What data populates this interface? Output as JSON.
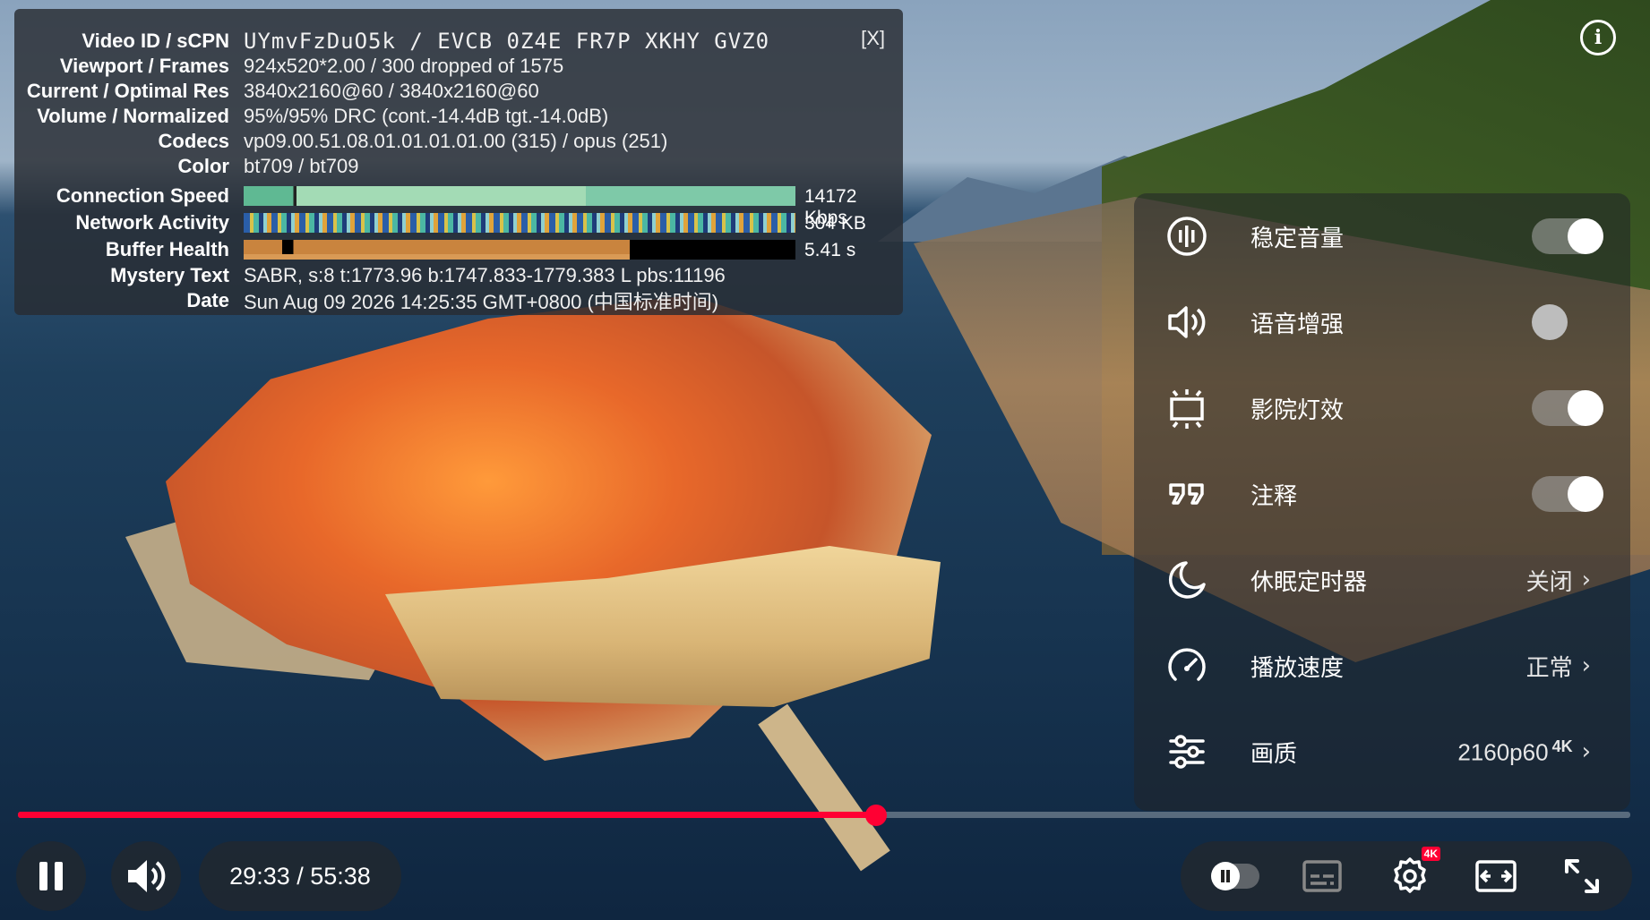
{
  "stats": {
    "close_label": "[X]",
    "rows": [
      {
        "label": "Video ID / sCPN",
        "value": "UYmvFzDuO5k / EVCB 0Z4E FR7P XKHY GVZ0"
      },
      {
        "label": "Viewport / Frames",
        "value": "924x520*2.00 / 300 dropped of 1575"
      },
      {
        "label": "Current / Optimal Res",
        "value": "3840x2160@60 / 3840x2160@60"
      },
      {
        "label": "Volume / Normalized",
        "value": "95%/95% DRC (cont.-14.4dB tgt.-14.0dB)"
      },
      {
        "label": "Codecs",
        "value": "vp09.00.51.08.01.01.01.01.00 (315) / opus (251)"
      },
      {
        "label": "Color",
        "value": "bt709 / bt709"
      },
      {
        "label": "Connection Speed",
        "value": "14172 Kbps"
      },
      {
        "label": "Network Activity",
        "value": "304 KB"
      },
      {
        "label": "Buffer Health",
        "value": "5.41 s"
      },
      {
        "label": "Mystery Text",
        "value": "SABR, s:8 t:1773.96 b:1747.833-1779.383 L pbs:11196"
      },
      {
        "label": "Date",
        "value": "Sun Aug 09 2026 14:25:35 GMT+0800 (中国标准时间)"
      }
    ]
  },
  "settings": {
    "items": [
      {
        "label": "稳定音量",
        "icon": "stable-volume-icon",
        "toggle": true
      },
      {
        "label": "语音增强",
        "icon": "voice-boost-icon",
        "toggle": false
      },
      {
        "label": "影院灯效",
        "icon": "ambient-mode-icon",
        "toggle": true
      },
      {
        "label": "注释",
        "icon": "annotations-icon",
        "toggle": true
      },
      {
        "label": "休眠定时器",
        "icon": "sleep-timer-icon",
        "value": "关闭"
      },
      {
        "label": "播放速度",
        "icon": "playback-speed-icon",
        "value": "正常"
      },
      {
        "label": "画质",
        "icon": "quality-icon",
        "value": "2160p60",
        "badge": "4K"
      }
    ]
  },
  "player": {
    "current_time": "29:33",
    "separator": " / ",
    "duration": "55:38",
    "progress_fraction": 0.532,
    "hd_badge": "4K",
    "accent": "#ff0033"
  }
}
